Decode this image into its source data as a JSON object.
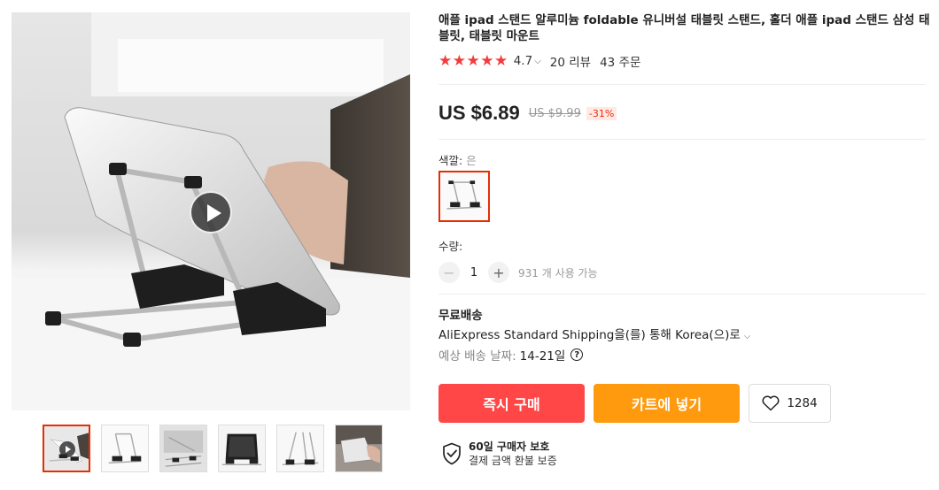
{
  "product": {
    "title": "애플 ipad 스탠드 알루미늄 foldable 유니버설 태블릿 스탠드, 홀더 애플 ipad 스탠드 삼성 태블릿, 태블릿 마운트",
    "stars": "★★★★★",
    "rating": "4.7",
    "reviews": "20 리뷰",
    "orders": "43 주문"
  },
  "price": {
    "current": "US $6.89",
    "original": "US $9.99",
    "discount": "-31%"
  },
  "variant": {
    "label": "색깔: ",
    "selected": "은"
  },
  "quantity": {
    "label": "수량:",
    "value": "1",
    "stock": "931 개 사용 가능"
  },
  "shipping": {
    "title": "무료배송",
    "method": "AliExpress Standard Shipping을(를) 통해 Korea(으)로",
    "eta_label": "예상 배송 날짜:",
    "eta_value": "14-21일"
  },
  "actions": {
    "buy_now": "즉시 구매",
    "add_to_cart": "카트에 넣기",
    "wishlist_count": "1284"
  },
  "protection": {
    "title": "60일 구매자 보호",
    "subtitle": "결제 금액 환불 보증"
  },
  "icons": {
    "play": "play-icon",
    "heart": "heart-icon",
    "shield": "shield-check-icon",
    "help": "help-icon",
    "chevron": "chevron-down-icon"
  },
  "colors": {
    "buy": "#ff4747",
    "cart": "#ff9a0e",
    "star": "#f23c3c",
    "accent": "#e62e04"
  }
}
